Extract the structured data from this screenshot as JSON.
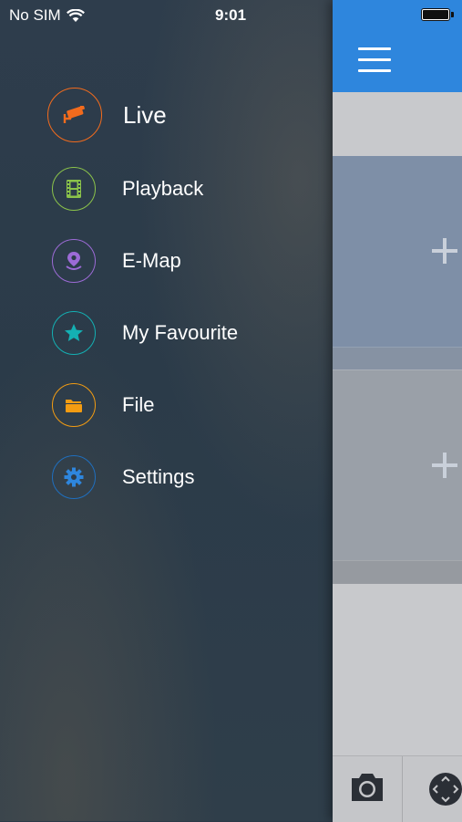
{
  "status_bar": {
    "carrier": "No SIM",
    "time": "9:01"
  },
  "menu": {
    "items": [
      {
        "label": "Live",
        "icon": "cctv-camera-icon",
        "color": "#f26b1d"
      },
      {
        "label": "Playback",
        "icon": "film-icon",
        "color": "#8bc34a"
      },
      {
        "label": "E-Map",
        "icon": "map-pin-icon",
        "color": "#9c6bd6"
      },
      {
        "label": "My Favourite",
        "icon": "star-icon",
        "color": "#14b0b3"
      },
      {
        "label": "File",
        "icon": "folder-icon",
        "color": "#f39c12"
      },
      {
        "label": "Settings",
        "icon": "gear-icon",
        "color": "#2e86dd"
      }
    ]
  },
  "colors": {
    "accent_bar": "#2e86dd"
  }
}
